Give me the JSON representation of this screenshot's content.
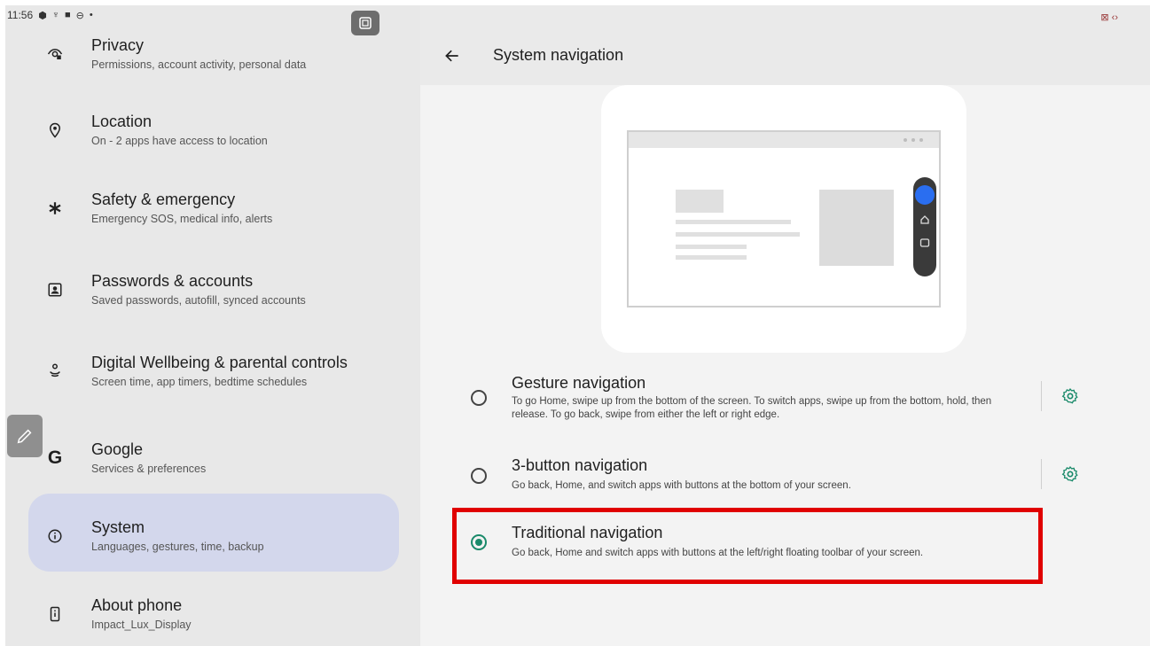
{
  "status_bar": {
    "time": "11:56",
    "icons": [
      "shield-icon",
      "usb-icon",
      "square-icon",
      "globe-icon",
      "dot-icon"
    ],
    "right_text": "⊠ ‹›"
  },
  "sidebar": {
    "items": [
      {
        "title": "Privacy",
        "subtitle": "Permissions, account activity, personal data",
        "icon": "privacy-eye-icon"
      },
      {
        "title": "Location",
        "subtitle": "On - 2 apps have access to location",
        "icon": "location-pin-icon"
      },
      {
        "title": "Safety & emergency",
        "subtitle": "Emergency SOS, medical info, alerts",
        "icon": "asterisk-icon"
      },
      {
        "title": "Passwords & accounts",
        "subtitle": "Saved passwords, autofill, synced accounts",
        "icon": "account-box-icon"
      },
      {
        "title": "Digital Wellbeing & parental controls",
        "subtitle": "Screen time, app timers, bedtime schedules",
        "icon": "wellbeing-icon"
      },
      {
        "title": "Google",
        "subtitle": "Services & preferences",
        "icon": "google-g-icon"
      },
      {
        "title": "System",
        "subtitle": "Languages, gestures, time, backup",
        "icon": "info-icon",
        "selected": true
      },
      {
        "title": "About phone",
        "subtitle": "Impact_Lux_Display",
        "icon": "phone-icon"
      }
    ]
  },
  "google_letter": "G",
  "page": {
    "title": "System navigation",
    "back_icon": "back-arrow-icon"
  },
  "options": [
    {
      "title": "Gesture navigation",
      "subtitle": "To go Home, swipe up from the bottom of the screen. To switch apps, swipe up from the bottom, hold, then release. To go back, swipe from either the left or right edge.",
      "checked": false,
      "has_settings": true
    },
    {
      "title": "3-button navigation",
      "subtitle": "Go back, Home, and switch apps with buttons at the bottom of your screen.",
      "checked": false,
      "has_settings": true
    },
    {
      "title": "Traditional navigation",
      "subtitle": "Go back, Home and switch apps with buttons at the left/right floating toolbar of your screen.",
      "checked": true,
      "has_settings": false
    }
  ],
  "colors": {
    "accent": "#1a8a6a",
    "selected_bg": "#d3d7ec",
    "highlight": "#e00000",
    "toolbar_blue": "#2a6ef0"
  }
}
